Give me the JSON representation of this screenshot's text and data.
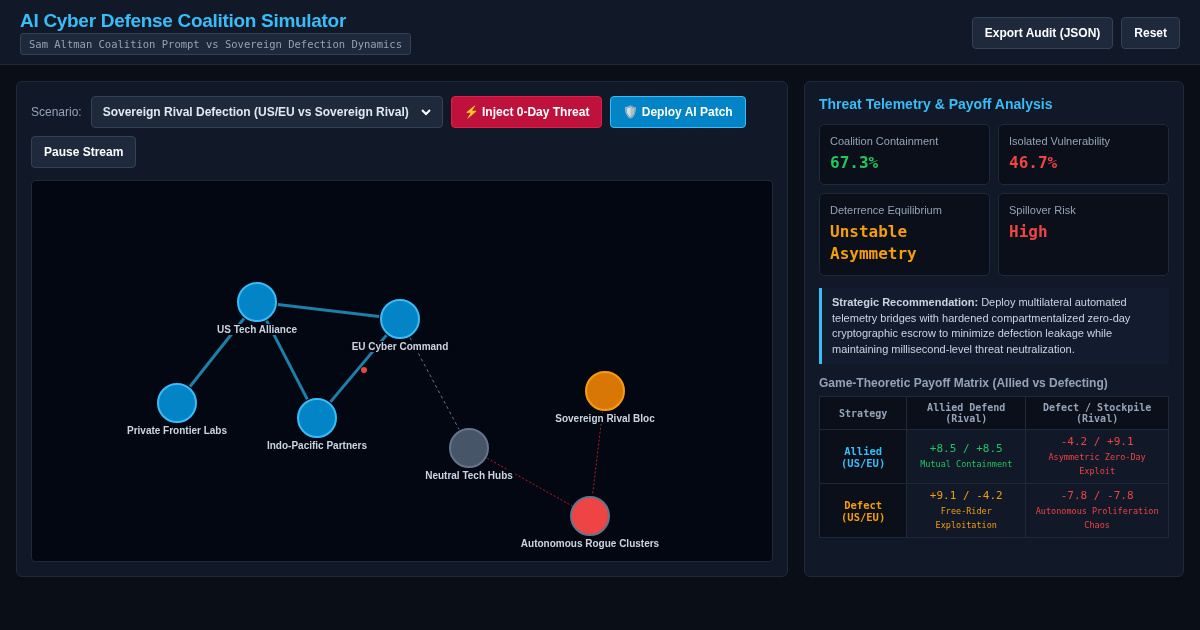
{
  "header": {
    "title": "AI Cyber Defense Coalition Simulator",
    "subtitle": "Sam Altman Coalition Prompt vs Sovereign Defection Dynamics",
    "buttons": [
      "Export Audit (JSON)",
      "Reset"
    ]
  },
  "controls": {
    "scenario_label": "Scenario:",
    "scenario_value": "Sovereign Rival Defection (US/EU vs Sovereign Rival)",
    "buttons": [
      {
        "label": "⚡ Inject 0-Day Threat",
        "kind": "danger"
      },
      {
        "label": "🛡️ Deploy AI Patch",
        "kind": "primary"
      },
      {
        "label": "Pause Stream",
        "kind": "plain"
      }
    ]
  },
  "graph": {
    "nodes": [
      {
        "label": "US Tech Alliance",
        "color": "#0284c7"
      },
      {
        "label": "EU Cyber Command",
        "color": "#0284c7"
      },
      {
        "label": "Private Frontier Labs",
        "color": "#0284c7"
      },
      {
        "label": "Indo-Pacific Partners",
        "color": "#0284c7"
      },
      {
        "label": "Neutral Tech Hubs",
        "color": "#475569"
      },
      {
        "label": "Sovereign Rival Bloc",
        "color": "#d97706"
      },
      {
        "label": "Autonomous Rogue Clusters",
        "color": "#ef4444"
      }
    ]
  },
  "analysis": {
    "title": "Threat Telemetry & Payoff Analysis",
    "metrics": [
      {
        "label": "Coalition Containment",
        "value": "67.3%",
        "color": "#22c55e"
      },
      {
        "label": "Isolated Vulnerability",
        "value": "46.7%",
        "color": "#ef4444"
      },
      {
        "label": "Deterrence Equilibrium",
        "value": "Unstable Asymmetry",
        "color": "#f59e0b"
      },
      {
        "label": "Spillover Risk",
        "value": "High",
        "color": "#ef4444"
      }
    ],
    "recommendation": "**Strategic Recommendation:** Deploy multilateral automated telemetry bridges with hardened compartmentalized zero-day cryptographic escrow to minimize defection leakage while maintaining millisecond-level threat neutralization.",
    "matrix_title": "Game-Theoretic Payoff Matrix (Allied vs Defecting)",
    "columns": [
      "Strategy",
      "Allied Defend (Rival)",
      "Defect / Stockpile (Rival)"
    ],
    "rows": [
      {
        "cells": [
          {
            "kind": "strategy",
            "text": "Allied (US/EU)",
            "color": "#38bdf8"
          },
          {
            "kind": "payoff",
            "payoff": "+8.5 / +8.5",
            "note": "Mutual Containment",
            "color": "#22c55e"
          },
          {
            "kind": "payoff",
            "payoff": "-4.2 / +9.1",
            "note": "Asymmetric Zero-Day Exploit",
            "color": "#ef4444"
          }
        ]
      },
      {
        "cells": [
          {
            "kind": "strategy",
            "text": "Defect (US/EU)",
            "color": "#f59e0b"
          },
          {
            "kind": "payoff",
            "payoff": "+9.1 / -4.2",
            "note": "Free-Rider Exploitation",
            "color": "#f59e0b"
          },
          {
            "kind": "payoff",
            "payoff": "-7.8 / -7.8",
            "note": "Autonomous Proliferation Chaos",
            "color": "#ef4444"
          }
        ]
      }
    ]
  }
}
